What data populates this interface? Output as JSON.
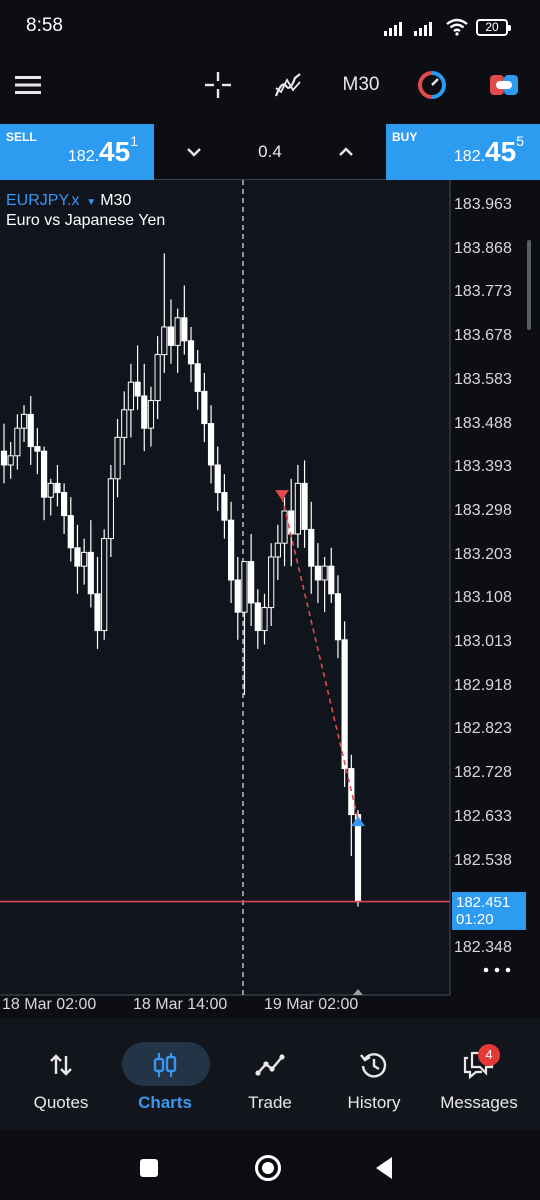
{
  "status": {
    "time": "8:58",
    "battery": "20"
  },
  "toolbar": {
    "timeframe": "M30",
    "icons": [
      "menu-icon",
      "crosshair-icon",
      "indicators-icon",
      "timeframe",
      "trade-objects-icon",
      "one-click-trading-icon"
    ]
  },
  "trade": {
    "sell_label": "SELL",
    "sell_price_small": "182.",
    "sell_price_big": "45",
    "sell_price_sup": "1",
    "buy_label": "BUY",
    "buy_price_small": "182.",
    "buy_price_big": "45",
    "buy_price_sup": "5",
    "volume": "0.4"
  },
  "chart": {
    "symbol": "EURJPY.x",
    "timeframe": "M30",
    "description": "Euro vs Japanese Yen",
    "current_price": "182.451",
    "countdown": "01:20",
    "y_ticks": [
      "183.963",
      "183.868",
      "183.773",
      "183.678",
      "183.583",
      "183.488",
      "183.393",
      "183.298",
      "183.203",
      "183.108",
      "183.013",
      "182.918",
      "182.823",
      "182.728",
      "182.633",
      "182.538",
      "182.348"
    ],
    "x_ticks": [
      "18 Mar 02:00",
      "18 Mar 14:00",
      "19 Mar 02:00"
    ],
    "colors": {
      "candle": "#ffffff",
      "bid_line": "#d9475b",
      "sell_marker": "#e04a4a",
      "buy_marker": "#3a96f3",
      "accent": "#2d9bf0"
    }
  },
  "chart_data": {
    "type": "candlestick",
    "symbol": "EURJPY.x",
    "ylim": [
      182.3,
      184.0
    ],
    "series": [
      {
        "name": "EURJPY.x",
        "values": [
          [
            183.43,
            183.49,
            183.36,
            183.4
          ],
          [
            183.4,
            183.45,
            183.37,
            183.42
          ],
          [
            183.42,
            183.51,
            183.39,
            183.48
          ],
          [
            183.48,
            183.53,
            183.45,
            183.51
          ],
          [
            183.51,
            183.55,
            183.4,
            183.44
          ],
          [
            183.44,
            183.48,
            183.38,
            183.43
          ],
          [
            183.43,
            183.44,
            183.28,
            183.33
          ],
          [
            183.33,
            183.37,
            183.29,
            183.36
          ],
          [
            183.36,
            183.4,
            183.31,
            183.34
          ],
          [
            183.34,
            183.36,
            183.25,
            183.29
          ],
          [
            183.29,
            183.33,
            183.19,
            183.22
          ],
          [
            183.22,
            183.27,
            183.12,
            183.18
          ],
          [
            183.18,
            183.24,
            183.14,
            183.21
          ],
          [
            183.21,
            183.28,
            183.09,
            183.12
          ],
          [
            183.12,
            183.2,
            183.0,
            183.04
          ],
          [
            183.04,
            183.26,
            183.02,
            183.24
          ],
          [
            183.24,
            183.4,
            183.2,
            183.37
          ],
          [
            183.37,
            183.5,
            183.33,
            183.46
          ],
          [
            183.46,
            183.56,
            183.4,
            183.52
          ],
          [
            183.52,
            183.62,
            183.46,
            183.58
          ],
          [
            183.58,
            183.66,
            183.52,
            183.55
          ],
          [
            183.55,
            183.62,
            183.43,
            183.48
          ],
          [
            183.48,
            183.57,
            183.44,
            183.54
          ],
          [
            183.54,
            183.68,
            183.5,
            183.64
          ],
          [
            183.64,
            183.86,
            183.6,
            183.7
          ],
          [
            183.7,
            183.76,
            183.62,
            183.66
          ],
          [
            183.66,
            183.74,
            183.6,
            183.72
          ],
          [
            183.72,
            183.79,
            183.64,
            183.67
          ],
          [
            183.67,
            183.7,
            183.58,
            183.62
          ],
          [
            183.62,
            183.65,
            183.52,
            183.56
          ],
          [
            183.56,
            183.6,
            183.45,
            183.49
          ],
          [
            183.49,
            183.53,
            183.36,
            183.4
          ],
          [
            183.4,
            183.44,
            183.3,
            183.34
          ],
          [
            183.34,
            183.38,
            183.24,
            183.28
          ],
          [
            183.28,
            183.32,
            183.1,
            183.15
          ],
          [
            183.15,
            183.2,
            183.02,
            183.08
          ],
          [
            183.08,
            183.14,
            182.9,
            183.19
          ],
          [
            183.19,
            183.25,
            183.05,
            183.1
          ],
          [
            183.1,
            183.13,
            183.0,
            183.04
          ],
          [
            183.04,
            183.12,
            183.01,
            183.09
          ],
          [
            183.09,
            183.23,
            183.05,
            183.2
          ],
          [
            183.2,
            183.27,
            183.15,
            183.23
          ],
          [
            183.23,
            183.33,
            183.18,
            183.3
          ],
          [
            183.3,
            183.37,
            183.18,
            183.25
          ],
          [
            183.25,
            183.4,
            183.22,
            183.36
          ],
          [
            183.36,
            183.41,
            183.22,
            183.26
          ],
          [
            183.26,
            183.32,
            183.12,
            183.18
          ],
          [
            183.18,
            183.23,
            183.1,
            183.15
          ],
          [
            183.15,
            183.2,
            183.08,
            183.18
          ],
          [
            183.18,
            183.22,
            183.1,
            183.12
          ],
          [
            183.12,
            183.16,
            182.98,
            183.02
          ],
          [
            183.02,
            183.06,
            182.7,
            182.74
          ],
          [
            182.74,
            182.77,
            182.55,
            182.64
          ],
          [
            182.64,
            182.65,
            182.44,
            182.45
          ]
        ]
      }
    ],
    "current_price": 182.451
  },
  "nav": {
    "items": [
      {
        "label": "Quotes"
      },
      {
        "label": "Charts"
      },
      {
        "label": "Trade"
      },
      {
        "label": "History"
      },
      {
        "label": "Messages"
      }
    ],
    "badge": "4"
  }
}
